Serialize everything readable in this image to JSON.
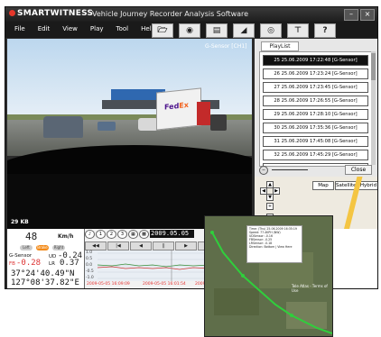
{
  "app": {
    "brand": "SMARTWITNESS",
    "title": "Vehicle Journey Recorder Analysis Software",
    "window_buttons": [
      "–",
      "×"
    ]
  },
  "menu": [
    "File",
    "Edit",
    "View",
    "Play",
    "Tool",
    "Help"
  ],
  "toolbar": {
    "icons": [
      "folder-icon",
      "camera-icon",
      "print-icon",
      "clapper-icon",
      "disc-icon",
      "antenna-icon",
      "help-icon"
    ],
    "help_label": "?"
  },
  "video": {
    "channel_label": "G-Sensor [CH1]",
    "size_label": "29 KB"
  },
  "playlist": {
    "tab_label": "PlayList",
    "items": [
      "25  25.06.2009 17:22:48 [G-Sensor]",
      "26  25.06.2009 17:23:24 [G-Sensor]",
      "27  25.06.2009 17:23:45 [G-Sensor]",
      "28  25.06.2009 17:26:55 [G-Sensor]",
      "29  25.06.2009 17:28:10 [G-Sensor]",
      "30  25.06.2009 17:35:36 [G-Sensor]",
      "31  25.06.2009 17:45:08 [G-Sensor]",
      "32  25.06.2009 17:45:29 [G-Sensor]",
      "33  25.06.2009 17:48:22 [G-Sensor]"
    ],
    "selected_index": 0,
    "close_label": "Close"
  },
  "map": {
    "types": [
      "Map",
      "Satellite",
      "Hybrid"
    ],
    "labels": [
      "Columbia Ave",
      "Tele Atlas"
    ]
  },
  "gauge": {
    "speed": "48",
    "unit": "Km/h",
    "indicators": [
      "Left",
      "Brake",
      "Right"
    ],
    "indicator_on": [
      false,
      true,
      false
    ],
    "gsensor_label": "G-Sensor",
    "gsensor_ud_label": "UD",
    "gsensor_ud_value": "-0.24",
    "gsensor_fb_label": "FB",
    "gsensor_fb_value": "-0.28",
    "gsensor_lr_label": "LR",
    "gsensor_lr_value": "0.37",
    "latitude": "37°24'40.49\"N",
    "longitude": "127°08'37.82\"E"
  },
  "player": {
    "date_display": "2009.05.05",
    "transport": [
      "◀◀",
      "|◀",
      "◀",
      "||",
      "▶",
      "▶|"
    ],
    "graph_yticks": [
      "1.0",
      "0.5",
      "0.0",
      "-0.5",
      "-1.0"
    ],
    "time_labels": [
      "2009-05-05 16:09:09",
      "2009-05-05 16:01:54",
      "2009-05-05"
    ]
  },
  "popup": {
    "info_lines": [
      "Time: (Thu) 25.06.2009 16:35:19",
      "Speed: 77.4KPH (NW)",
      "UDSensor: -0.16",
      "FBSensor: -0.25",
      "LRSensor: -0.18",
      "Direction: Bottom | View Here"
    ],
    "terms": "Tele Atlas - Terms of Use"
  }
}
